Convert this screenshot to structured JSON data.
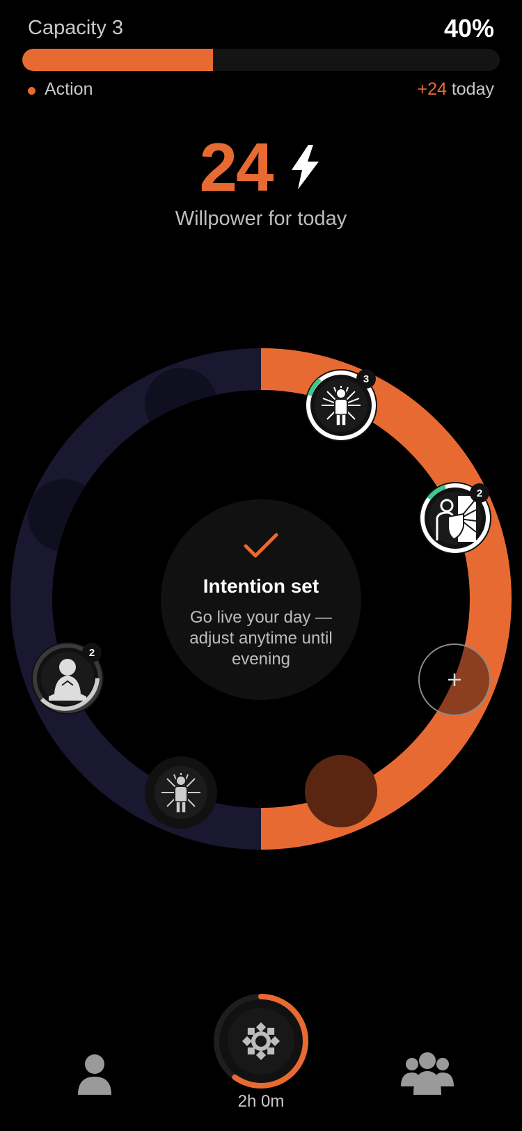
{
  "header": {
    "capacity_label": "Capacity 3",
    "capacity_percent_text": "40%",
    "capacity_fraction": 0.4,
    "legend_label": "Action",
    "today_delta": "+24",
    "today_suffix": " today"
  },
  "willpower": {
    "value": "24",
    "caption": "Willpower for today",
    "icon": "lightning-bolt-icon"
  },
  "center": {
    "icon": "checkmark-icon",
    "title": "Intention set",
    "subtitle": "Go live your day — adjust anytime until evening"
  },
  "ring_nodes": [
    {
      "name": "radiant-person-node",
      "icon": "radiant-person-icon",
      "badge": "3"
    },
    {
      "name": "shield-person-node",
      "icon": "shield-person-icon",
      "badge": "2"
    },
    {
      "name": "meditation-node",
      "icon": "meditating-person-icon",
      "badge": "2"
    },
    {
      "name": "radiant-person-small-node",
      "icon": "radiant-person-icon",
      "badge": ""
    },
    {
      "name": "add-node",
      "icon": "plus-icon",
      "badge": ""
    }
  ],
  "bottom_nav": {
    "profile_icon": "person-icon",
    "settings_icon": "sun-gear-icon",
    "timer_text": "2h 0m",
    "timer_progress": 0.6,
    "community_icon": "group-icon"
  },
  "colors": {
    "accent": "#e86a33",
    "ring_dark": "#1a1730",
    "progress_green": "#3ec98a",
    "background": "#000000"
  }
}
